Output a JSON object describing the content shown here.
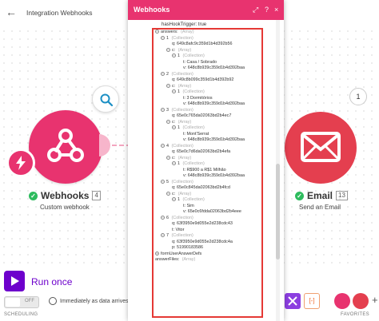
{
  "topbar": {
    "back_icon": "arrow-left-icon",
    "scenario_title": "Integration Webhooks"
  },
  "modules": {
    "webhooks": {
      "title": "Webhooks",
      "index": "4",
      "subtitle": "Custom webhook",
      "color": "#e8336f"
    },
    "email": {
      "title": "Email",
      "index": "13",
      "subtitle": "Send an Email",
      "color": "#e43f4f",
      "bundle_count": "1"
    }
  },
  "toolbar": {
    "run_once_label": "Run once",
    "toggle_label": "OFF",
    "schedule_text": "Immediately as data arrives.",
    "scheduling_label": "SCHEDULING",
    "tools_label": "[-]",
    "favorites_label": "FAVORITES",
    "add_label": "+"
  },
  "panel": {
    "title": "Webhooks",
    "header_icons": [
      "expand-icon",
      "help-icon",
      "close-icon"
    ],
    "hook_trigger_line": "hasHookTrigger: true",
    "tree_rows": [
      {
        "text": "answers: ",
        "hint": "(Array)",
        "toggle": "−",
        "indent": 0
      },
      {
        "text": "1 ",
        "hint": "(Collection)",
        "toggle": "−",
        "indent": 1
      },
      {
        "text": "q: 649c8afc9c359d1b4d392b56",
        "hint": "",
        "toggle": "",
        "indent": 3
      },
      {
        "text": "c: ",
        "hint": "(Array)",
        "toggle": "−",
        "indent": 2
      },
      {
        "text": "1 ",
        "hint": "(Collection)",
        "toggle": "−",
        "indent": 3
      },
      {
        "text": "t: Casa / Sobrado",
        "hint": "",
        "toggle": "",
        "indent": 5
      },
      {
        "text": "v: 648c8b939c359d1b4d392baa",
        "hint": "",
        "toggle": "",
        "indent": 5
      },
      {
        "text": "2 ",
        "hint": "(Collection)",
        "toggle": "−",
        "indent": 1
      },
      {
        "text": "q: 649c8b099c359d1b4d392b92",
        "hint": "",
        "toggle": "",
        "indent": 3
      },
      {
        "text": "c: ",
        "hint": "(Array)",
        "toggle": "−",
        "indent": 2
      },
      {
        "text": "1 ",
        "hint": "(Collection)",
        "toggle": "−",
        "indent": 3
      },
      {
        "text": "t: 3 Dormitórios",
        "hint": "",
        "toggle": "",
        "indent": 5
      },
      {
        "text": "v: 648c8b939c359d1b4d392baa",
        "hint": "",
        "toggle": "",
        "indent": 5
      },
      {
        "text": "3 ",
        "hint": "(Collection)",
        "toggle": "−",
        "indent": 1
      },
      {
        "text": "q: 65e0c765da02063bd2b4ec7",
        "hint": "",
        "toggle": "",
        "indent": 3
      },
      {
        "text": "c: ",
        "hint": "(Array)",
        "toggle": "−",
        "indent": 2
      },
      {
        "text": "1 ",
        "hint": "(Collection)",
        "toggle": "−",
        "indent": 3
      },
      {
        "text": "t: Mont'Serrat",
        "hint": "",
        "toggle": "",
        "indent": 5
      },
      {
        "text": "v: 648c8b939c359d1b4d392baa",
        "hint": "",
        "toggle": "",
        "indent": 5
      },
      {
        "text": "4 ",
        "hint": "(Collection)",
        "toggle": "−",
        "indent": 1
      },
      {
        "text": "q: 65e0c7d6da02063bd2b4efa",
        "hint": "",
        "toggle": "",
        "indent": 3
      },
      {
        "text": "c: ",
        "hint": "(Array)",
        "toggle": "−",
        "indent": 2
      },
      {
        "text": "1 ",
        "hint": "(Collection)",
        "toggle": "−",
        "indent": 3
      },
      {
        "text": "t: R$900 a R$1 Milhão",
        "hint": "",
        "toggle": "",
        "indent": 5
      },
      {
        "text": "v: 648c8b939c359d1b4d392baa",
        "hint": "",
        "toggle": "",
        "indent": 5
      },
      {
        "text": "5 ",
        "hint": "(Collection)",
        "toggle": "−",
        "indent": 1
      },
      {
        "text": "q: 65e0c845da02063bd2b4fcd",
        "hint": "",
        "toggle": "",
        "indent": 3
      },
      {
        "text": "c: ",
        "hint": "(Array)",
        "toggle": "−",
        "indent": 2
      },
      {
        "text": "1 ",
        "hint": "(Collection)",
        "toggle": "−",
        "indent": 3
      },
      {
        "text": "t: Sim",
        "hint": "",
        "toggle": "",
        "indent": 5
      },
      {
        "text": "v: 65e0c6fdda02063bd2b4eee",
        "hint": "",
        "toggle": "",
        "indent": 5
      },
      {
        "text": "6 ",
        "hint": "(Collection)",
        "toggle": "−",
        "indent": 1
      },
      {
        "text": "q: 63f3950e9d055e2d238cdc43",
        "hint": "",
        "toggle": "",
        "indent": 3
      },
      {
        "text": "t: Vitor",
        "hint": "",
        "toggle": "",
        "indent": 3
      },
      {
        "text": "7 ",
        "hint": "(Collection)",
        "toggle": "−",
        "indent": 1
      },
      {
        "text": "q: 63f3950e9d055e2d238cdc4a",
        "hint": "",
        "toggle": "",
        "indent": 3
      },
      {
        "text": "p: 51990183586",
        "hint": "",
        "toggle": "",
        "indent": 3
      },
      {
        "text": "formUserAnswerDefs",
        "hint": "",
        "toggle": "+",
        "indent": 0
      },
      {
        "text": "answerFiles: ",
        "hint": "(Array)",
        "toggle": "",
        "indent": 0
      }
    ]
  }
}
